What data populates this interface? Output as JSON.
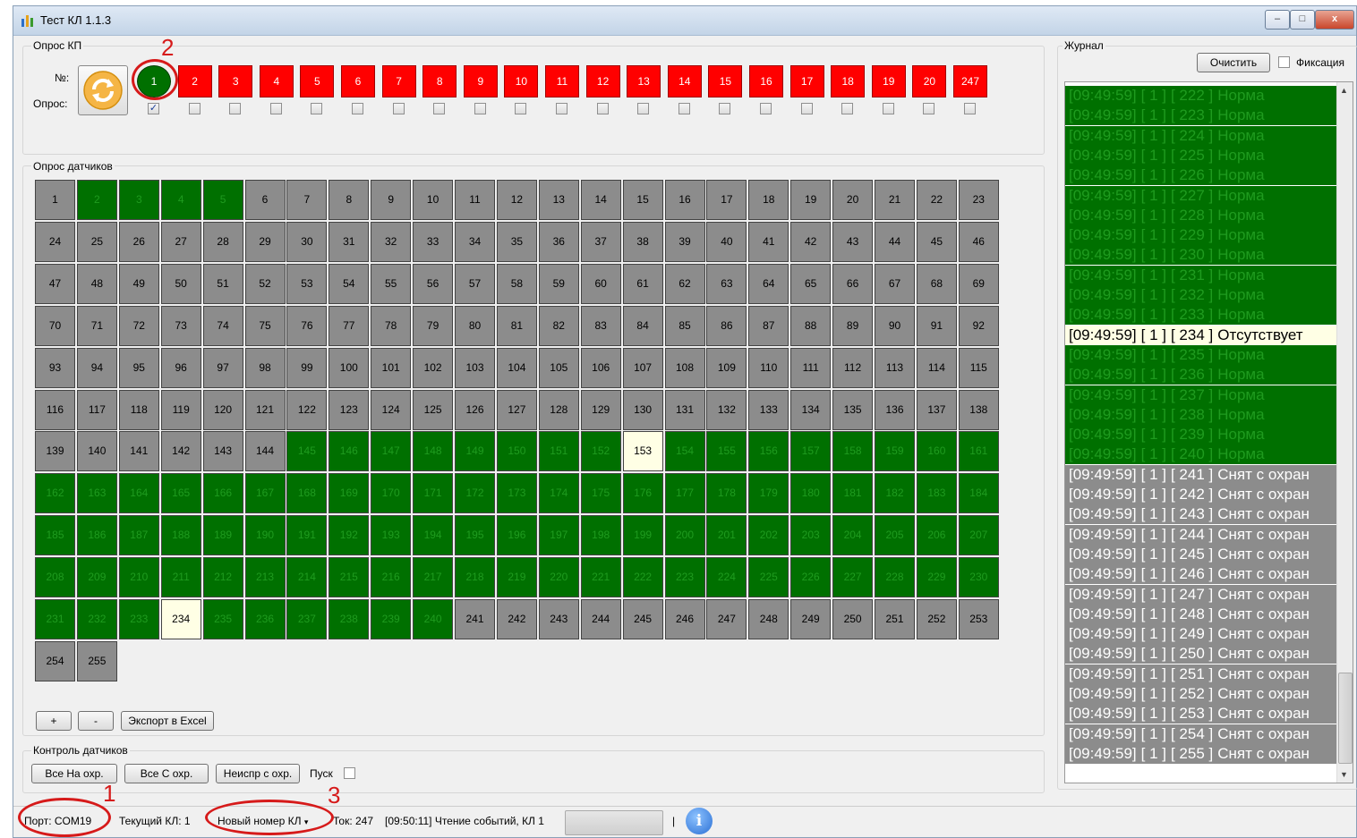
{
  "window": {
    "title": "Тест КЛ 1.1.3",
    "buttons": {
      "minimize": "–",
      "maximize": "□",
      "close": "x"
    }
  },
  "kp_poll": {
    "label": "Опрос КП",
    "num_label": "№:",
    "poll_label": "Опрос:",
    "items": [
      {
        "label": "1",
        "state": "green",
        "checked": true
      },
      {
        "label": "2",
        "state": "red",
        "checked": false
      },
      {
        "label": "3",
        "state": "red",
        "checked": false
      },
      {
        "label": "4",
        "state": "red",
        "checked": false
      },
      {
        "label": "5",
        "state": "red",
        "checked": false
      },
      {
        "label": "6",
        "state": "red",
        "checked": false
      },
      {
        "label": "7",
        "state": "red",
        "checked": false
      },
      {
        "label": "8",
        "state": "red",
        "checked": false
      },
      {
        "label": "9",
        "state": "red",
        "checked": false
      },
      {
        "label": "10",
        "state": "red",
        "checked": false
      },
      {
        "label": "11",
        "state": "red",
        "checked": false
      },
      {
        "label": "12",
        "state": "red",
        "checked": false
      },
      {
        "label": "13",
        "state": "red",
        "checked": false
      },
      {
        "label": "14",
        "state": "red",
        "checked": false
      },
      {
        "label": "15",
        "state": "red",
        "checked": false
      },
      {
        "label": "16",
        "state": "red",
        "checked": false
      },
      {
        "label": "17",
        "state": "red",
        "checked": false
      },
      {
        "label": "18",
        "state": "red",
        "checked": false
      },
      {
        "label": "19",
        "state": "red",
        "checked": false
      },
      {
        "label": "20",
        "state": "red",
        "checked": false
      },
      {
        "label": "247",
        "state": "red",
        "checked": false
      }
    ],
    "refresh_icon": "refresh-icon"
  },
  "sensors": {
    "label": "Опрос датчиков",
    "green_numbers": [
      2,
      3,
      4,
      5,
      145,
      146,
      147,
      148,
      149,
      150,
      151,
      152,
      154,
      155,
      156,
      157,
      158,
      159,
      160,
      161,
      162,
      163,
      164,
      165,
      166,
      167,
      168,
      169,
      170,
      171,
      172,
      173,
      174,
      175,
      176,
      177,
      178,
      179,
      180,
      181,
      182,
      183,
      184,
      185,
      186,
      187,
      188,
      189,
      190,
      191,
      192,
      193,
      194,
      195,
      196,
      197,
      198,
      199,
      200,
      201,
      202,
      203,
      204,
      205,
      206,
      207,
      208,
      209,
      210,
      211,
      212,
      213,
      214,
      215,
      216,
      217,
      218,
      219,
      220,
      221,
      222,
      223,
      224,
      225,
      226,
      227,
      228,
      229,
      230,
      231,
      232,
      233,
      235,
      236,
      237,
      238,
      239,
      240
    ],
    "pale_numbers": [
      153,
      234
    ],
    "count": 255,
    "colors": {
      "gray": "#8c8c8c",
      "green": "#007000",
      "pale": "#ffffe5"
    }
  },
  "grid_buttons": {
    "plus": "+",
    "minus": "-",
    "export": "Экспорт в Excel"
  },
  "control": {
    "label": "Контроль датчиков",
    "all_on": "Все На охр.",
    "all_off": "Все С охр.",
    "faulty": "Неиспр с охр.",
    "start": "Пуск"
  },
  "journal": {
    "label": "Журнал",
    "clear": "Очистить",
    "fix": "Фиксация",
    "rows": [
      {
        "time": "[09:49:59]",
        "kl": "[ 1 ]",
        "num": "[ 222 ]",
        "text": "Норма",
        "state": "green"
      },
      {
        "time": "[09:49:59]",
        "kl": "[ 1 ]",
        "num": "[ 223 ]",
        "text": "Норма",
        "state": "green"
      },
      {
        "time": "[09:49:59]",
        "kl": "[ 1 ]",
        "num": "[ 224 ]",
        "text": "Норма",
        "state": "green"
      },
      {
        "time": "[09:49:59]",
        "kl": "[ 1 ]",
        "num": "[ 225 ]",
        "text": "Норма",
        "state": "green"
      },
      {
        "time": "[09:49:59]",
        "kl": "[ 1 ]",
        "num": "[ 226 ]",
        "text": "Норма",
        "state": "green"
      },
      {
        "time": "[09:49:59]",
        "kl": "[ 1 ]",
        "num": "[ 227 ]",
        "text": "Норма",
        "state": "green"
      },
      {
        "time": "[09:49:59]",
        "kl": "[ 1 ]",
        "num": "[ 228 ]",
        "text": "Норма",
        "state": "green"
      },
      {
        "time": "[09:49:59]",
        "kl": "[ 1 ]",
        "num": "[ 229 ]",
        "text": "Норма",
        "state": "green"
      },
      {
        "time": "[09:49:59]",
        "kl": "[ 1 ]",
        "num": "[ 230 ]",
        "text": "Норма",
        "state": "green"
      },
      {
        "time": "[09:49:59]",
        "kl": "[ 1 ]",
        "num": "[ 231 ]",
        "text": "Норма",
        "state": "green"
      },
      {
        "time": "[09:49:59]",
        "kl": "[ 1 ]",
        "num": "[ 232 ]",
        "text": "Норма",
        "state": "green"
      },
      {
        "time": "[09:49:59]",
        "kl": "[ 1 ]",
        "num": "[ 233 ]",
        "text": "Норма",
        "state": "green"
      },
      {
        "time": "[09:49:59]",
        "kl": "[ 1 ]",
        "num": "[ 234 ]",
        "text": "Отсутствует",
        "state": "pale"
      },
      {
        "time": "[09:49:59]",
        "kl": "[ 1 ]",
        "num": "[ 235 ]",
        "text": "Норма",
        "state": "green"
      },
      {
        "time": "[09:49:59]",
        "kl": "[ 1 ]",
        "num": "[ 236 ]",
        "text": "Норма",
        "state": "green"
      },
      {
        "time": "[09:49:59]",
        "kl": "[ 1 ]",
        "num": "[ 237 ]",
        "text": "Норма",
        "state": "green"
      },
      {
        "time": "[09:49:59]",
        "kl": "[ 1 ]",
        "num": "[ 238 ]",
        "text": "Норма",
        "state": "green"
      },
      {
        "time": "[09:49:59]",
        "kl": "[ 1 ]",
        "num": "[ 239 ]",
        "text": "Норма",
        "state": "green"
      },
      {
        "time": "[09:49:59]",
        "kl": "[ 1 ]",
        "num": "[ 240 ]",
        "text": "Норма",
        "state": "green"
      },
      {
        "time": "[09:49:59]",
        "kl": "[ 1 ]",
        "num": "[ 241 ]",
        "text": "Снят с охран",
        "state": "gray"
      },
      {
        "time": "[09:49:59]",
        "kl": "[ 1 ]",
        "num": "[ 242 ]",
        "text": "Снят с охран",
        "state": "gray"
      },
      {
        "time": "[09:49:59]",
        "kl": "[ 1 ]",
        "num": "[ 243 ]",
        "text": "Снят с охран",
        "state": "gray"
      },
      {
        "time": "[09:49:59]",
        "kl": "[ 1 ]",
        "num": "[ 244 ]",
        "text": "Снят с охран",
        "state": "gray"
      },
      {
        "time": "[09:49:59]",
        "kl": "[ 1 ]",
        "num": "[ 245 ]",
        "text": "Снят с охран",
        "state": "gray"
      },
      {
        "time": "[09:49:59]",
        "kl": "[ 1 ]",
        "num": "[ 246 ]",
        "text": "Снят с охран",
        "state": "gray"
      },
      {
        "time": "[09:49:59]",
        "kl": "[ 1 ]",
        "num": "[ 247 ]",
        "text": "Снят с охран",
        "state": "gray"
      },
      {
        "time": "[09:49:59]",
        "kl": "[ 1 ]",
        "num": "[ 248 ]",
        "text": "Снят с охран",
        "state": "gray"
      },
      {
        "time": "[09:49:59]",
        "kl": "[ 1 ]",
        "num": "[ 249 ]",
        "text": "Снят с охран",
        "state": "gray"
      },
      {
        "time": "[09:49:59]",
        "kl": "[ 1 ]",
        "num": "[ 250 ]",
        "text": "Снят с охран",
        "state": "gray"
      },
      {
        "time": "[09:49:59]",
        "kl": "[ 1 ]",
        "num": "[ 251 ]",
        "text": "Снят с охран",
        "state": "gray"
      },
      {
        "time": "[09:49:59]",
        "kl": "[ 1 ]",
        "num": "[ 252 ]",
        "text": "Снят с охран",
        "state": "gray"
      },
      {
        "time": "[09:49:59]",
        "kl": "[ 1 ]",
        "num": "[ 253 ]",
        "text": "Снят с охран",
        "state": "gray"
      },
      {
        "time": "[09:49:59]",
        "kl": "[ 1 ]",
        "num": "[ 254 ]",
        "text": "Снят с охран",
        "state": "gray"
      },
      {
        "time": "[09:49:59]",
        "kl": "[ 1 ]",
        "num": "[ 255 ]",
        "text": "Снят с охран",
        "state": "gray"
      }
    ]
  },
  "statusbar": {
    "port": "Порт: COM19",
    "current_kl": "Текущий КЛ: 1",
    "new_number": "Новый номер КЛ",
    "tok": "Ток:  247",
    "event": "[09:50:11] Чтение событий, КЛ 1",
    "separator": "|",
    "info_icon": "info-icon"
  },
  "annotations": {
    "a1": "1",
    "a2": "2",
    "a3": "3"
  }
}
